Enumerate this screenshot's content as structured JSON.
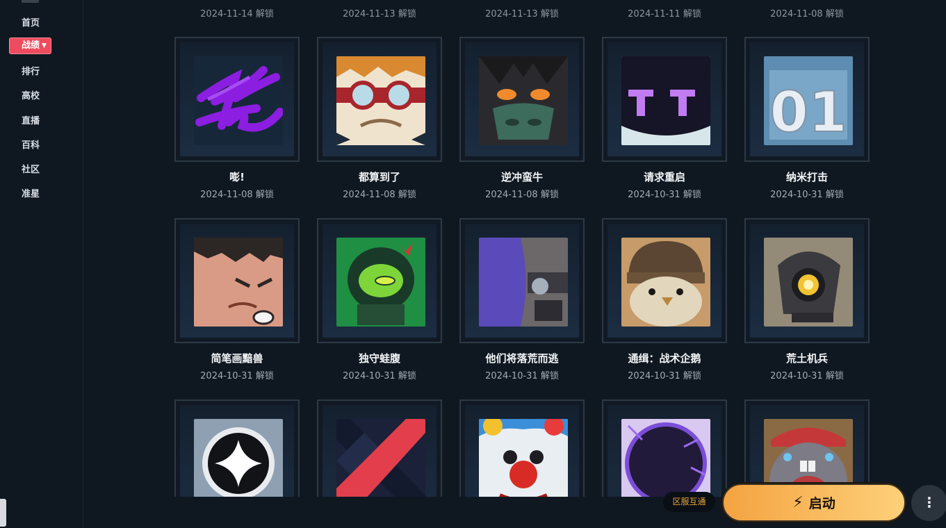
{
  "sidebar": {
    "items": [
      {
        "label": "首页"
      },
      {
        "label": "战绩",
        "active": true
      },
      {
        "label": "排行"
      },
      {
        "label": "高校"
      },
      {
        "label": "直播"
      },
      {
        "label": "百科"
      },
      {
        "label": "社区"
      },
      {
        "label": "准星"
      }
    ]
  },
  "top_row_dates": [
    "2024-11-14 解锁",
    "2024-11-13 解锁",
    "2024-11-13 解锁",
    "2024-11-11 解锁",
    "2024-11-08 解锁"
  ],
  "badges": [
    {
      "name": "嘭!",
      "date": "2024-11-08 解锁",
      "icon": "purple-scribble-icon"
    },
    {
      "name": "都算到了",
      "date": "2024-11-08 解锁",
      "icon": "goggles-face-icon"
    },
    {
      "name": "逆冲蛮牛",
      "date": "2024-11-08 解锁",
      "icon": "masked-bull-icon"
    },
    {
      "name": "请求重启",
      "date": "2024-10-31 解锁",
      "icon": "robot-helmet-icon"
    },
    {
      "name": "纳米打击",
      "date": "2024-10-31 解锁",
      "icon": "number-01-icon"
    },
    {
      "name": "简笔画黯兽",
      "date": "2024-10-31 解锁",
      "icon": "angry-face-icon"
    },
    {
      "name": "独守蛙腹",
      "date": "2024-10-31 解锁",
      "icon": "frog-soldier-icon"
    },
    {
      "name": "他们将落荒而逃",
      "date": "2024-10-31 解锁",
      "icon": "purple-gunner-icon"
    },
    {
      "name": "通缉：战术企鹅",
      "date": "2024-10-31 解锁",
      "icon": "penguin-beanie-icon"
    },
    {
      "name": "荒土机兵",
      "date": "2024-10-31 解锁",
      "icon": "robot-eye-icon"
    },
    {
      "name": "",
      "date": "",
      "icon": "star-orb-icon"
    },
    {
      "name": "",
      "date": "",
      "icon": "red-chevron-icon"
    },
    {
      "name": "",
      "date": "",
      "icon": "clown-icon"
    },
    {
      "name": "",
      "date": "",
      "icon": "purple-portal-icon"
    },
    {
      "name": "",
      "date": "",
      "icon": "crying-mole-icon"
    }
  ],
  "footer": {
    "region_label": "区服互通",
    "launch_label": "启动",
    "launch_icon": "lightning-icon",
    "more_icon": "more-vertical-icon",
    "accent": "#f4a341",
    "nav_active_color": "#ef4b5e"
  }
}
